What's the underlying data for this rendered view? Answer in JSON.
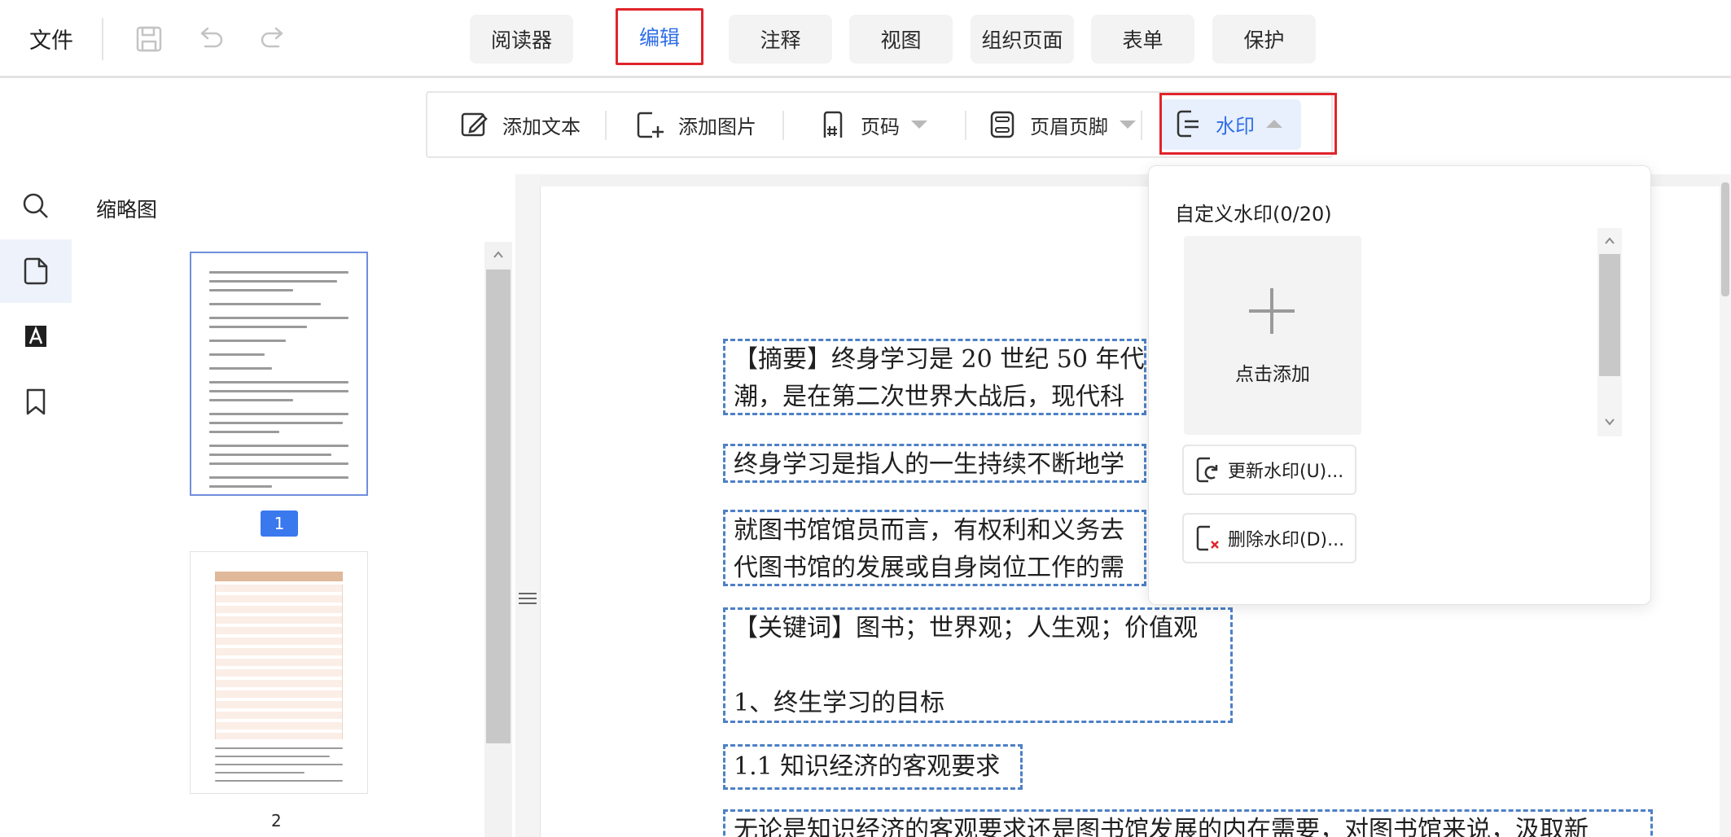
{
  "menu": {
    "file": "文件"
  },
  "quick_icons": {
    "save": "save-icon",
    "undo": "undo-icon",
    "redo": "redo-icon"
  },
  "tabs": [
    {
      "label": "阅读器",
      "active": false
    },
    {
      "label": "编辑",
      "active": true
    },
    {
      "label": "注释",
      "active": false
    },
    {
      "label": "视图",
      "active": false
    },
    {
      "label": "组织页面",
      "active": false
    },
    {
      "label": "表单",
      "active": false
    },
    {
      "label": "保护",
      "active": false
    }
  ],
  "toolbar": {
    "add_text": "添加文本",
    "add_image": "添加图片",
    "page_number": "页码",
    "header_footer": "页眉页脚",
    "watermark": "水印"
  },
  "sidebar": {
    "panel_title": "缩略图",
    "pages": [
      "1",
      "2"
    ],
    "selected_page": "1"
  },
  "document": {
    "lines": [
      "【摘要】终身学习是 20 世纪 50 年代",
      "潮，是在第二次世界大战后，现代科",
      "终身学习是指人的一生持续不断地学",
      "就图书馆馆员而言，有权利和义务去",
      "代图书馆的发展或自身岗位工作的需",
      "【关键词】图书；世界观；人生观；价值观",
      "1、终生学习的目标",
      "1.1 知识经济的客观要求",
      "无论是知识经济的客观要求还是图书馆发展的内在需要，对图书馆来说，汲取新"
    ]
  },
  "watermark_panel": {
    "title": "自定义水印(0/20)",
    "add_label": "点击添加",
    "update": "更新水印(U)...",
    "delete": "删除水印(D)..."
  },
  "colors": {
    "accent": "#2f6ee8",
    "highlight": "#e0242c",
    "badge": "#3a78ee",
    "dashed_box": "#4d80c6"
  }
}
